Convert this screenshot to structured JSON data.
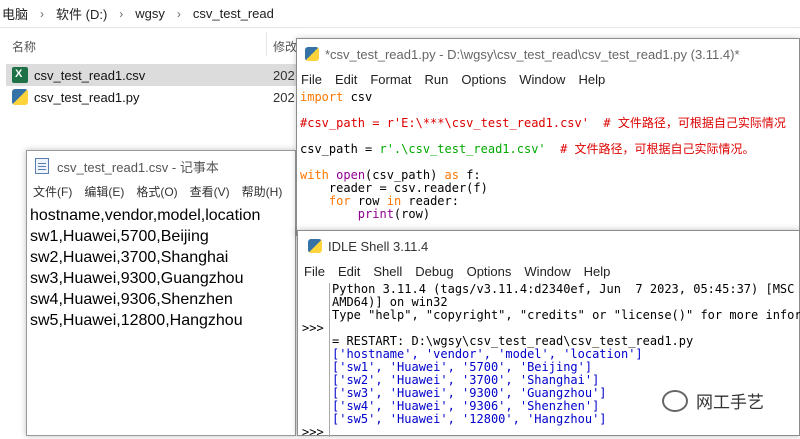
{
  "explorer": {
    "breadcrumb": [
      "电脑",
      "软件 (D:)",
      "wgsy",
      "csv_test_read"
    ],
    "columns": {
      "name": "名称",
      "modified": "修改"
    },
    "files": [
      {
        "name": "csv_test_read1.csv",
        "date": "202",
        "icon": "excel-csv-icon"
      },
      {
        "name": "csv_test_read1.py",
        "date": "202",
        "icon": "python-file-icon"
      }
    ]
  },
  "notepad": {
    "title": "csv_test_read1.csv - 记事本",
    "menu": [
      "文件(F)",
      "编辑(E)",
      "格式(O)",
      "查看(V)",
      "帮助(H)"
    ],
    "lines": [
      "hostname,vendor,model,location",
      "sw1,Huawei,5700,Beijing",
      "sw2,Huawei,3700,Shanghai",
      "sw3,Huawei,9300,Guangzhou",
      "sw4,Huawei,9306,Shenzhen",
      "sw5,Huawei,12800,Hangzhou"
    ]
  },
  "editor": {
    "title": "*csv_test_read1.py - D:\\wgsy\\csv_test_read\\csv_test_read1.py (3.11.4)*",
    "menu": [
      "File",
      "Edit",
      "Format",
      "Run",
      "Options",
      "Window",
      "Help"
    ],
    "code": {
      "l1_kw": "import",
      "l1_rest": " csv",
      "l2_comment": "#csv_path = r'E:\\***\\csv_test_read1.csv'  # 文件路径，可根据自己实际情况",
      "l3_var": "csv_path = ",
      "l3_str": "r'.\\csv_test_read1.csv'",
      "l3_comment": "  # 文件路径，可根据自己实际情况。",
      "l4_kw": "with",
      "l4_bi": "open",
      "l4_mid": "(csv_path) ",
      "l4_kw2": "as",
      "l4_end": " f:",
      "l5": "    reader = csv.reader(f)",
      "l6_indent": "    ",
      "l6_kw": "for",
      "l6_mid": " row ",
      "l6_kw2": "in",
      "l6_end": " reader:",
      "l7_indent": "        ",
      "l7_bi": "print",
      "l7_end": "(row)"
    }
  },
  "shell": {
    "title": "IDLE Shell 3.11.4",
    "menu": [
      "File",
      "Edit",
      "Shell",
      "Debug",
      "Options",
      "Window",
      "Help"
    ],
    "prompt": ">>>",
    "banner": [
      "Python 3.11.4 (tags/v3.11.4:d2340ef, Jun  7 2023, 05:45:37) [MSC v.",
      "AMD64)] on win32",
      "Type \"help\", \"copyright\", \"credits\" or \"license()\" for more informa"
    ],
    "restart": "= RESTART: D:\\wgsy\\csv_test_read\\csv_test_read1.py",
    "output": [
      "['hostname', 'vendor', 'model', 'location']",
      "['sw1', 'Huawei', '5700', 'Beijing']",
      "['sw2', 'Huawei', '3700', 'Shanghai']",
      "['sw3', 'Huawei', '9300', 'Guangzhou']",
      "['sw4', 'Huawei', '9306', 'Shenzhen']",
      "['sw5', 'Huawei', '12800', 'Hangzhou']"
    ]
  },
  "watermark": {
    "text": "网工手艺"
  }
}
